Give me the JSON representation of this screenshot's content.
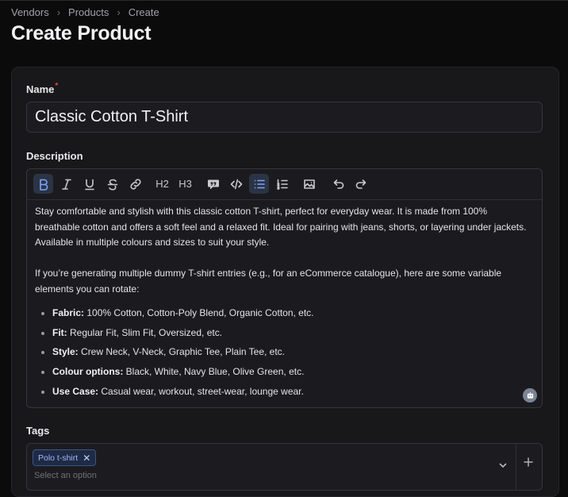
{
  "breadcrumb": [
    "Vendors",
    "Products",
    "Create"
  ],
  "page_title": "Create Product",
  "form": {
    "name_label": "Name",
    "required_mark": "*",
    "name_value": "Classic Cotton T-Shirt",
    "description_label": "Description",
    "toolbar": {
      "heading2": "H2",
      "heading3": "H3"
    },
    "description": {
      "p1": "Stay comfortable and stylish with this classic cotton T-shirt, perfect for everyday wear. It is made from 100% breathable cotton and offers a soft feel and a relaxed fit. Ideal for pairing with jeans, shorts, or layering under jackets. Available in multiple colours and sizes to suit your style.",
      "p2": "If you’re generating multiple dummy T-shirt entries (e.g., for an eCommerce catalogue), here are some variable elements you can rotate:",
      "items": [
        {
          "key": "Fabric:",
          "value": " 100% Cotton, Cotton-Poly Blend, Organic Cotton, etc."
        },
        {
          "key": "Fit:",
          "value": " Regular Fit, Slim Fit, Oversized, etc."
        },
        {
          "key": "Style:",
          "value": " Crew Neck, V-Neck, Graphic Tee, Plain Tee, etc."
        },
        {
          "key": "Colour options:",
          "value": " Black, White, Navy Blue, Olive Green, etc."
        },
        {
          "key": "Use Case:",
          "value": " Casual wear, workout, street-wear, lounge wear."
        }
      ]
    },
    "tags_label": "Tags",
    "tags": [
      "Polo t-shirt"
    ],
    "tags_placeholder": "Select an option"
  },
  "colors": {
    "accent": "#7aa4ff",
    "required": "#ef4444",
    "background": "#0b0b0c",
    "card": "#18181b"
  }
}
